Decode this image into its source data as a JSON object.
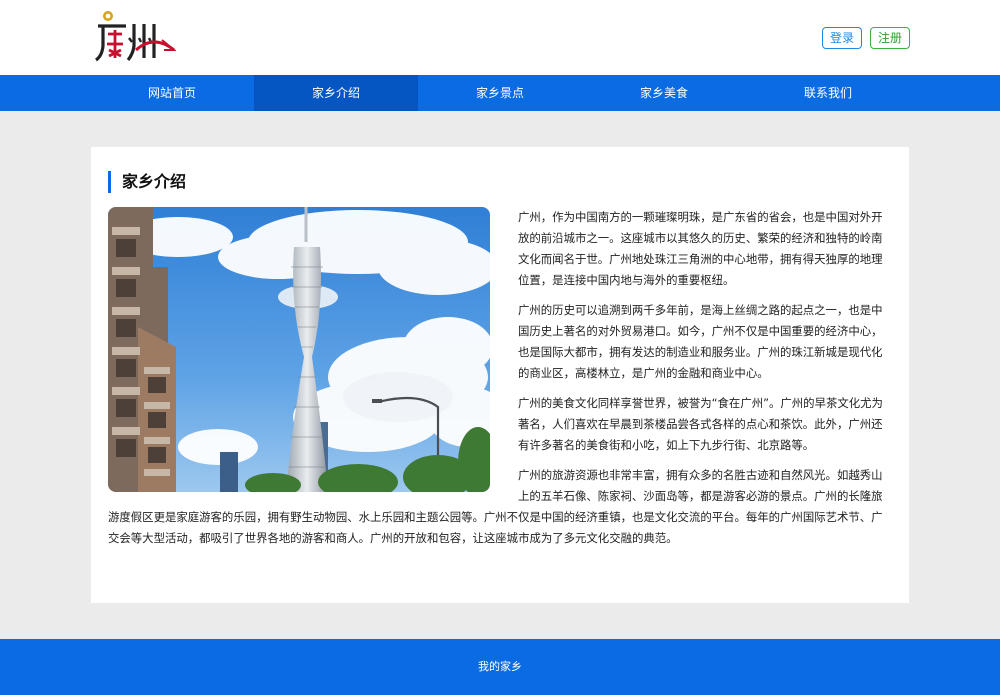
{
  "header": {
    "logo_text": "广州",
    "login_label": "登录",
    "register_label": "注册"
  },
  "nav": {
    "items": [
      {
        "label": "网站首页"
      },
      {
        "label": "家乡介绍"
      },
      {
        "label": "家乡景点"
      },
      {
        "label": "家乡美食"
      },
      {
        "label": "联系我们"
      }
    ],
    "active_index": 1
  },
  "main": {
    "section_title": "家乡介绍",
    "image_alt": "广州塔",
    "paragraphs": [
      "广州，作为中国南方的一颗璀璨明珠，是广东省的省会，也是中国对外开放的前沿城市之一。这座城市以其悠久的历史、繁荣的经济和独特的岭南文化而闻名于世。广州地处珠江三角洲的中心地带，拥有得天独厚的地理位置，是连接中国内地与海外的重要枢纽。",
      "广州的历史可以追溯到两千多年前，是海上丝绸之路的起点之一，也是中国历史上著名的对外贸易港口。如今，广州不仅是中国重要的经济中心，也是国际大都市，拥有发达的制造业和服务业。广州的珠江新城是现代化的商业区，高楼林立，是广州的金融和商业中心。",
      "广州的美食文化同样享誉世界，被誉为“食在广州”。广州的早茶文化尤为著名，人们喜欢在早晨到茶楼品尝各式各样的点心和茶饮。此外，广州还有许多著名的美食街和小吃，如上下九步行街、北京路等。",
      "广州的旅游资源也非常丰富，拥有众多的名胜古迹和自然风光。如越秀山上的五羊石像、陈家祠、沙面岛等，都是游客必游的景点。广州的长隆旅游度假区更是家庭游客的乐园，拥有野生动物园、水上乐园和主题公园等。广州不仅是中国的经济重镇，也是文化交流的平台。每年的广州国际艺术节、广交会等大型活动，都吸引了世界各地的游客和商人。广州的开放和包容，让这座城市成为了多元文化交融的典范。"
    ]
  },
  "footer": {
    "text": "我的家乡"
  },
  "colors": {
    "nav_blue": "#0a6be3",
    "nav_active": "#0556c2",
    "login_border": "#1e88e5",
    "register_border": "#3cb043",
    "page_bg": "#ebebeb"
  }
}
